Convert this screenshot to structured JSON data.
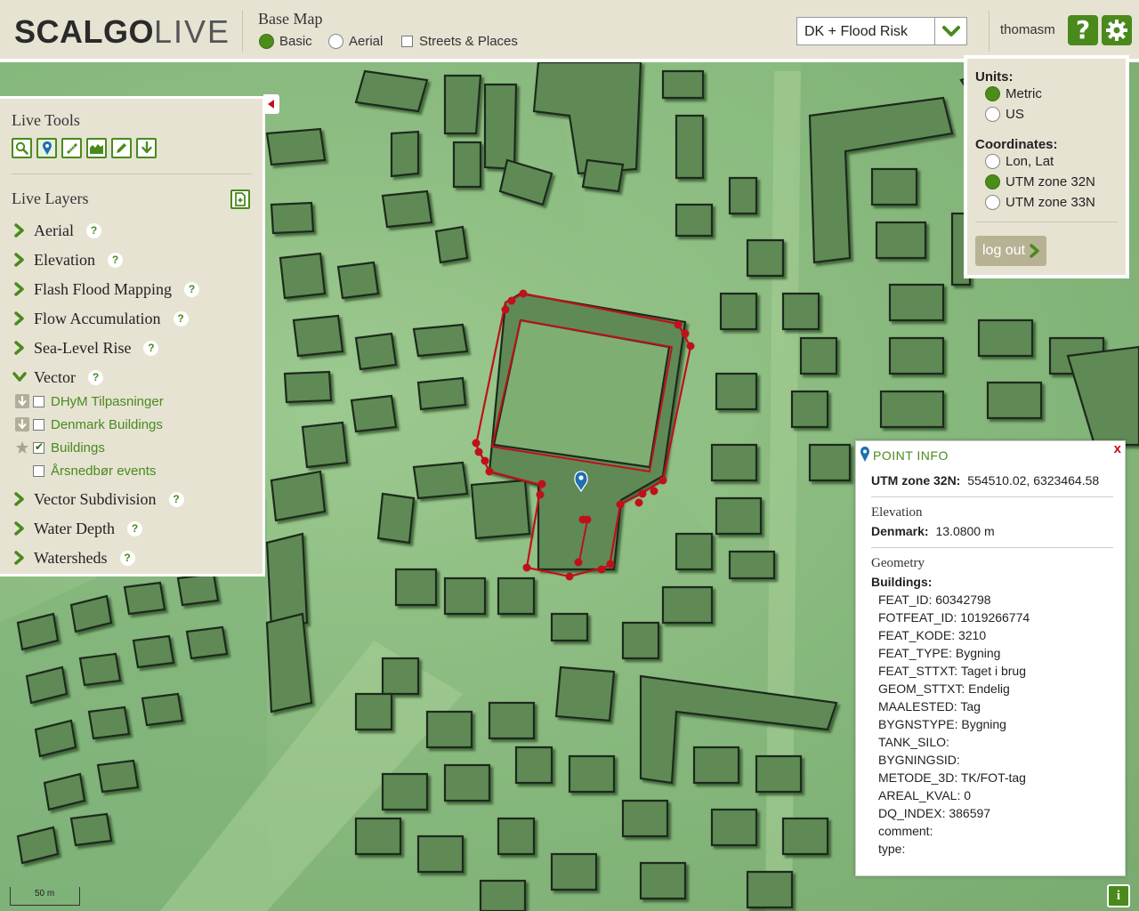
{
  "header": {
    "logo_bold": "SCALGO",
    "logo_light": "LIVE",
    "base_map": {
      "title": "Base Map",
      "options": [
        {
          "label": "Basic",
          "selected": true
        },
        {
          "label": "Aerial",
          "selected": false
        }
      ],
      "streets_label": "Streets & Places",
      "streets_checked": false
    },
    "dataset_select": "DK + Flood Risk",
    "username": "thomasm",
    "help_icon": "question-icon",
    "settings_icon": "gear-icon"
  },
  "settings": {
    "units_label": "Units:",
    "units": [
      {
        "label": "Metric",
        "selected": true
      },
      {
        "label": "US",
        "selected": false
      }
    ],
    "coords_label": "Coordinates:",
    "coords": [
      {
        "label": "Lon, Lat",
        "selected": false
      },
      {
        "label": "UTM zone 32N",
        "selected": true
      },
      {
        "label": "UTM zone 33N",
        "selected": false
      }
    ],
    "logout_label": "log out"
  },
  "panel": {
    "tools_title": "Live Tools",
    "tools": [
      "search-icon",
      "pin-icon",
      "ruler-icon",
      "terrain-icon",
      "pencil-icon",
      "download-icon"
    ],
    "layers_title": "Live Layers",
    "help_glyph": "?",
    "layers": [
      {
        "name": "Aerial",
        "expanded": false
      },
      {
        "name": "Elevation",
        "expanded": false
      },
      {
        "name": "Flash Flood Mapping",
        "expanded": false
      },
      {
        "name": "Flow Accumulation",
        "expanded": false
      },
      {
        "name": "Sea-Level Rise",
        "expanded": false
      },
      {
        "name": "Vector",
        "expanded": true
      },
      {
        "name": "Vector Subdivision",
        "expanded": false
      },
      {
        "name": "Water Depth",
        "expanded": false
      },
      {
        "name": "Watersheds",
        "expanded": false
      }
    ],
    "vector_sublayers": [
      {
        "name": "DHyM Tilpasninger",
        "checked": false,
        "icon": "download-icon"
      },
      {
        "name": "Denmark Buildings",
        "checked": false,
        "icon": "download-icon"
      },
      {
        "name": "Buildings",
        "checked": true,
        "icon": "star-icon"
      },
      {
        "name": "Årsnedbør events",
        "checked": false,
        "icon": ""
      }
    ]
  },
  "point_info": {
    "title": "POINT INFO",
    "close": "x",
    "coord_label": "UTM zone 32N:",
    "coord_value": "554510.02, 6323464.58",
    "elevation_section": "Elevation",
    "elevation_label": "Denmark:",
    "elevation_value": "13.0800 m",
    "geometry_section": "Geometry",
    "geometry_label": "Buildings:",
    "attributes": [
      "FEAT_ID: 60342798",
      "FOTFEAT_ID: 1019266774",
      "FEAT_KODE: 3210",
      "FEAT_TYPE: Bygning",
      "FEAT_STTXT: Taget i brug",
      "GEOM_STTXT: Endelig",
      "MAALESTED: Tag",
      "BYGNSTYPE: Bygning",
      "TANK_SILO:",
      "BYGNINGSID:",
      "METODE_3D: TK/FOT-tag",
      "AREAL_KVAL: 0",
      "DQ_INDEX: 386597",
      "comment:",
      "type:"
    ]
  },
  "map": {
    "scale_label": "50 m",
    "info_label": "i",
    "accent": "#4a8a1c",
    "highlight": "#c0101a"
  }
}
